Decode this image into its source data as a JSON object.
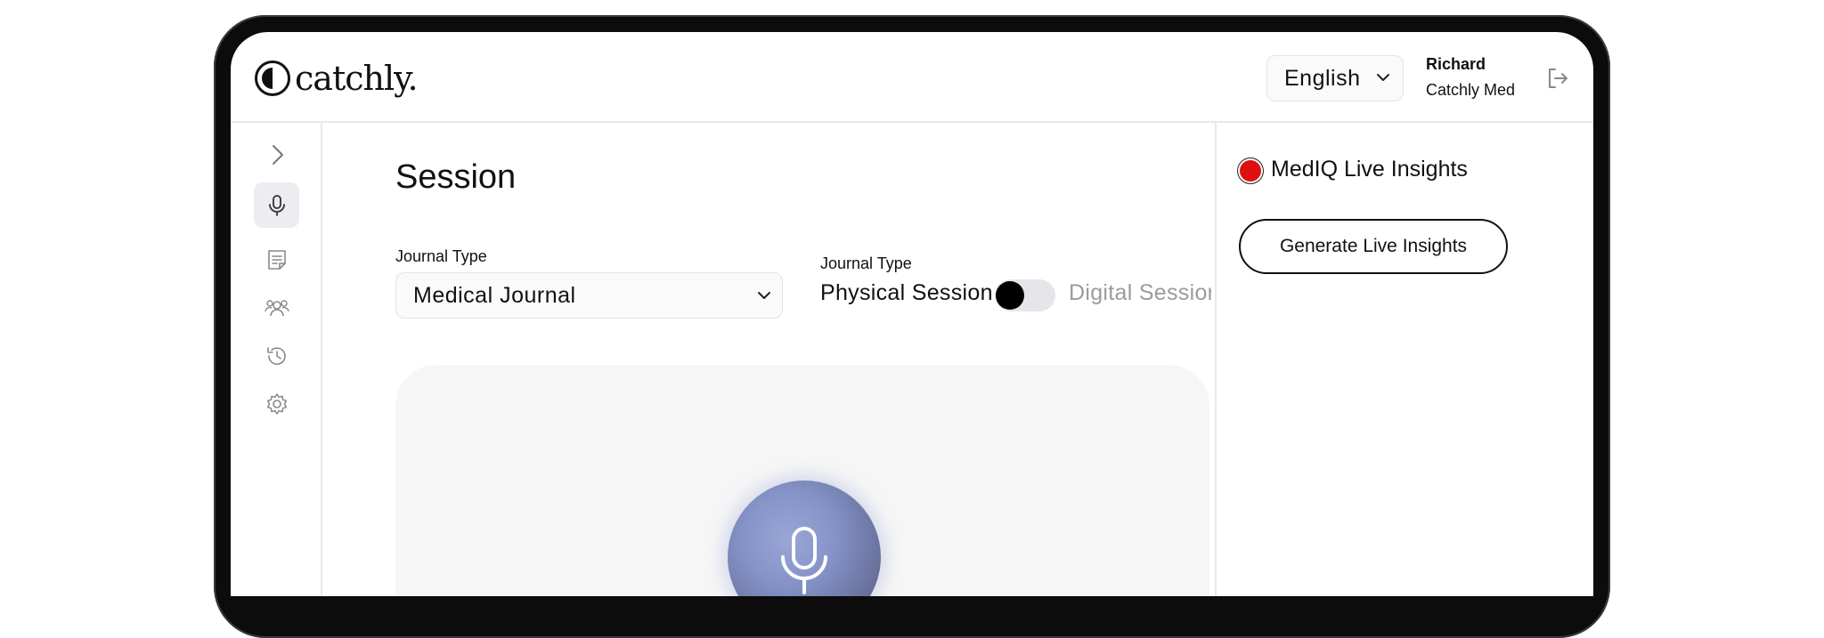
{
  "brand": {
    "name": "catchly."
  },
  "header": {
    "language": "English",
    "user_name": "Richard",
    "user_org": "Catchly Med"
  },
  "sidebar": {
    "items": [
      {
        "icon": "chevron-right-icon"
      },
      {
        "icon": "microphone-icon",
        "active": true
      },
      {
        "icon": "notes-icon"
      },
      {
        "icon": "users-icon"
      },
      {
        "icon": "history-icon"
      },
      {
        "icon": "gear-icon"
      }
    ]
  },
  "main": {
    "title": "Session",
    "journal_type_label": "Journal Type",
    "journal_type_value": "Medical Journal",
    "session_type_label": "Journal Type",
    "session_option_physical": "Physical Session",
    "session_option_digital": "Digital Session",
    "session_toggle_digital": false
  },
  "insights": {
    "title": "MedIQ Live Insights",
    "live_status_color": "#e01010",
    "generate_button": "Generate Live Insights"
  },
  "colors": {
    "accent_orb": "#8593c8",
    "active_nav_bg": "#ececf1"
  }
}
